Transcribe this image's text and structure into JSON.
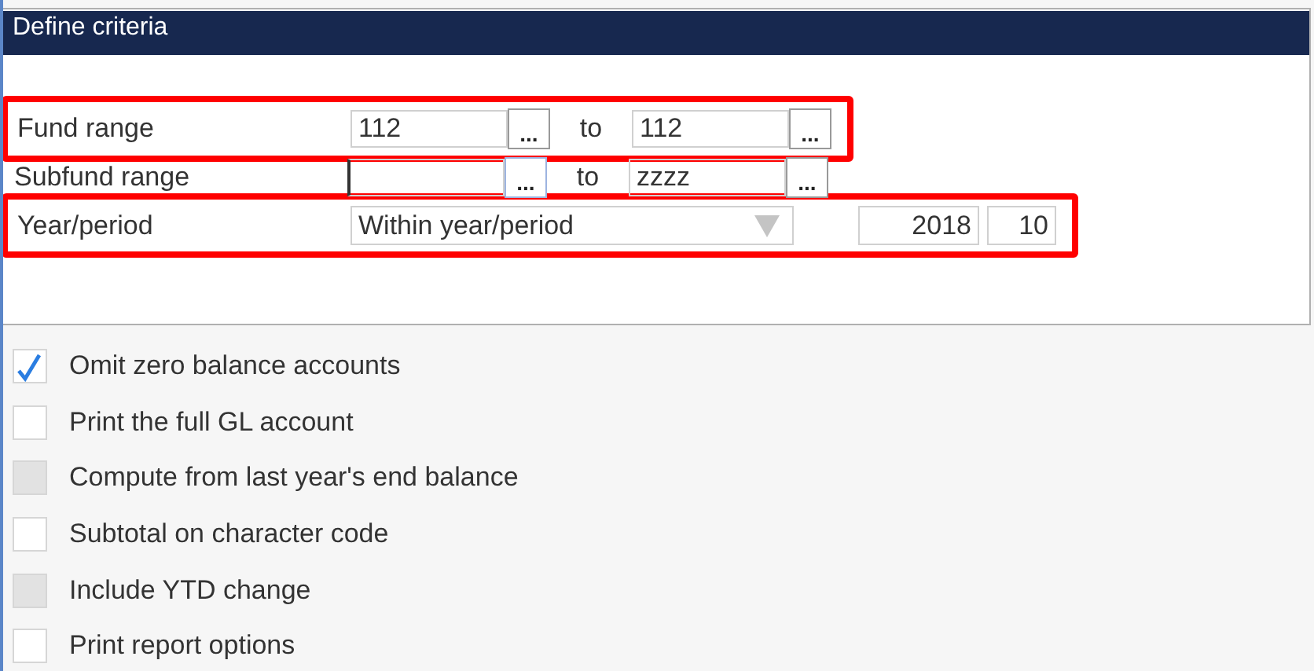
{
  "panel": {
    "title": "Define criteria"
  },
  "criteria": [
    {
      "kind": "range",
      "label": "Fund range",
      "highlighted": true,
      "from": {
        "value": "112",
        "focused": false
      },
      "from_button": "...",
      "separator": "to",
      "to": {
        "value": "112"
      },
      "to_button": "..."
    },
    {
      "kind": "range",
      "label": "Subfund range",
      "highlighted": false,
      "from": {
        "focused": true
      },
      "from_button": "...",
      "separator": "to",
      "to": {
        "value": "zzzz"
      },
      "to_button": "..."
    },
    {
      "kind": "period",
      "label": "Year/period",
      "highlighted": true,
      "dropdown": "Within year/period",
      "year": "2018",
      "period": "10"
    }
  ],
  "options": [
    {
      "label": "Omit zero balance accounts",
      "checked": true,
      "disabled": false
    },
    {
      "label": "Print the full GL account",
      "checked": false,
      "disabled": false
    },
    {
      "label": "Compute from last year's end balance",
      "checked": false,
      "disabled": true
    },
    {
      "label": "Subtotal on character code",
      "checked": false,
      "disabled": false
    },
    {
      "label": "Include YTD change",
      "checked": false,
      "disabled": true
    },
    {
      "label": "Print report options",
      "checked": false,
      "disabled": false
    }
  ]
}
